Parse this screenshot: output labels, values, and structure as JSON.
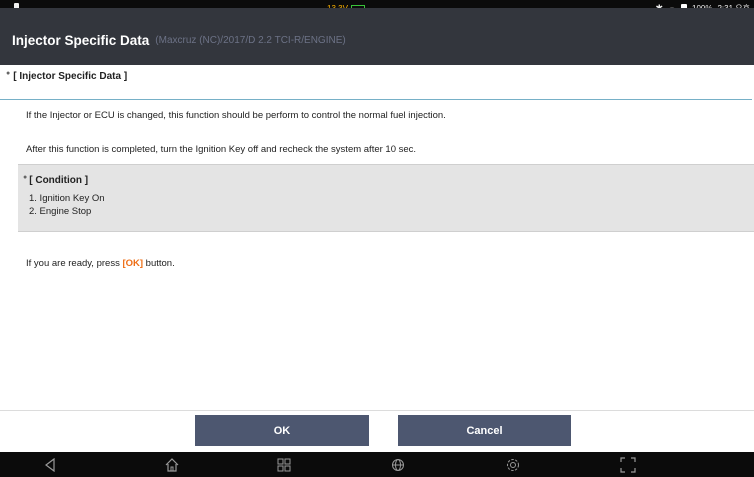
{
  "status_bar": {
    "voltage": "13.3V",
    "battery_percent": "100%",
    "time": "2:31 오후"
  },
  "header": {
    "title": "Injector Specific Data",
    "subtitle": "(Maxcruz (NC)/2017/D 2.2 TCI-R/ENGINE)"
  },
  "main": {
    "section_title": "[ Injector Specific Data ]",
    "paragraph1": "If the Injector or ECU is changed, this function should be perform to control the normal fuel injection.",
    "paragraph2": "After this function is completed, turn the Ignition Key off and recheck the system after 10 sec.",
    "condition": {
      "title": "[ Condition ]",
      "items": [
        "1. Ignition Key On",
        "2. Engine Stop"
      ]
    },
    "ready": {
      "prefix": "If you are ready, press ",
      "highlight": "[OK]",
      "suffix": " button."
    }
  },
  "buttons": {
    "ok": "OK",
    "cancel": "Cancel"
  },
  "nav": {
    "icons": [
      "back-icon",
      "home-icon",
      "recent-apps-icon",
      "globe-icon",
      "settings-icon",
      "screenshot-icon"
    ]
  },
  "colors": {
    "title_bar": "#33363d",
    "button": "#4d5770",
    "highlight": "#ee6e16",
    "voltage": "#ffb400",
    "rule": "#76b0c7"
  }
}
